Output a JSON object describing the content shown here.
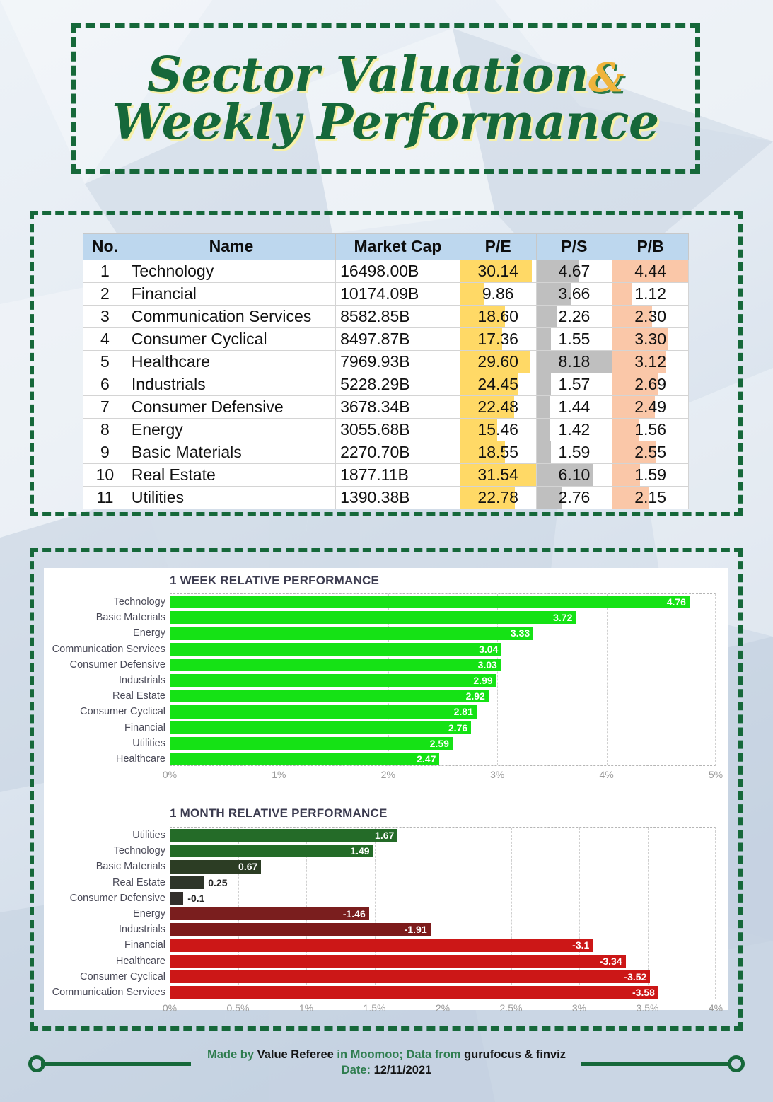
{
  "header": {
    "title_line1": "Sector Valuation",
    "title_amp": "&",
    "title_line2": "Weekly Performance"
  },
  "watermark": "Value Referee",
  "table": {
    "columns": [
      "No.",
      "Name",
      "Market Cap",
      "P/E",
      "P/S",
      "P/B"
    ],
    "colors": {
      "header_bg": "#bdd7ee",
      "pe_bar": "#ffd966",
      "ps_bar": "#bfbfbf",
      "pb_bar": "#fac7a8"
    },
    "rows": [
      {
        "no": "1",
        "name": "Technology",
        "market_cap": "16498.00B",
        "pe": "30.14",
        "ps": "4.67",
        "pb": "4.44",
        "pe_pct": 95,
        "ps_pct": 57,
        "pb_pct": 100
      },
      {
        "no": "2",
        "name": "Financial",
        "market_cap": "10174.09B",
        "pe": "9.86",
        "ps": "3.66",
        "pb": "1.12",
        "pe_pct": 31,
        "ps_pct": 45,
        "pb_pct": 25
      },
      {
        "no": "3",
        "name": "Communication Services",
        "market_cap": "8582.85B",
        "pe": "18.60",
        "ps": "2.26",
        "pb": "2.30",
        "pe_pct": 59,
        "ps_pct": 28,
        "pb_pct": 52
      },
      {
        "no": "4",
        "name": "Consumer Cyclical",
        "market_cap": "8497.87B",
        "pe": "17.36",
        "ps": "1.55",
        "pb": "3.30",
        "pe_pct": 55,
        "ps_pct": 19,
        "pb_pct": 74
      },
      {
        "no": "5",
        "name": "Healthcare",
        "market_cap": "7969.93B",
        "pe": "29.60",
        "ps": "8.18",
        "pb": "3.12",
        "pe_pct": 93,
        "ps_pct": 100,
        "pb_pct": 70
      },
      {
        "no": "6",
        "name": "Industrials",
        "market_cap": "5228.29B",
        "pe": "24.45",
        "ps": "1.57",
        "pb": "2.69",
        "pe_pct": 77,
        "ps_pct": 19,
        "pb_pct": 60
      },
      {
        "no": "7",
        "name": "Consumer Defensive",
        "market_cap": "3678.34B",
        "pe": "22.48",
        "ps": "1.44",
        "pb": "2.49",
        "pe_pct": 71,
        "ps_pct": 18,
        "pb_pct": 56
      },
      {
        "no": "8",
        "name": "Energy",
        "market_cap": "3055.68B",
        "pe": "15.46",
        "ps": "1.42",
        "pb": "1.56",
        "pe_pct": 49,
        "ps_pct": 17,
        "pb_pct": 35
      },
      {
        "no": "9",
        "name": "Basic Materials",
        "market_cap": "2270.70B",
        "pe": "18.55",
        "ps": "1.59",
        "pb": "2.55",
        "pe_pct": 59,
        "ps_pct": 19,
        "pb_pct": 57
      },
      {
        "no": "10",
        "name": "Real Estate",
        "market_cap": "1877.11B",
        "pe": "31.54",
        "ps": "6.10",
        "pb": "1.59",
        "pe_pct": 100,
        "ps_pct": 75,
        "pb_pct": 36
      },
      {
        "no": "11",
        "name": "Utilities",
        "market_cap": "1390.38B",
        "pe": "22.78",
        "ps": "2.76",
        "pb": "2.15",
        "pe_pct": 72,
        "ps_pct": 34,
        "pb_pct": 48
      }
    ]
  },
  "chart_data": [
    {
      "type": "bar",
      "orientation": "horizontal",
      "title": "1 WEEK RELATIVE PERFORMANCE",
      "xlabel": "",
      "ylabel": "",
      "xlim": [
        0,
        5
      ],
      "grid": true,
      "legend": "none",
      "tick_labels": [
        "0%",
        "1%",
        "2%",
        "3%",
        "4%",
        "5%"
      ],
      "tick_values": [
        0,
        1,
        2,
        3,
        4,
        5
      ],
      "categories": [
        "Technology",
        "Basic Materials",
        "Energy",
        "Communication Services",
        "Consumer Defensive",
        "Industrials",
        "Real Estate",
        "Consumer Cyclical",
        "Financial",
        "Utilities",
        "Healthcare"
      ],
      "values": [
        4.76,
        3.72,
        3.33,
        3.04,
        3.03,
        2.99,
        2.92,
        2.81,
        2.76,
        2.59,
        2.47
      ],
      "labels": [
        "4.76",
        "3.72",
        "3.33",
        "3.04",
        "3.03",
        "2.99",
        "2.92",
        "2.81",
        "2.76",
        "2.59",
        "2.47"
      ],
      "bar_colors": [
        "#15e215",
        "#15e215",
        "#15e215",
        "#15e215",
        "#15e215",
        "#15e215",
        "#15e215",
        "#15e215",
        "#15e215",
        "#15e215",
        "#15e215"
      ]
    },
    {
      "type": "bar",
      "orientation": "horizontal",
      "title": "1 MONTH RELATIVE PERFORMANCE",
      "xlabel": "",
      "ylabel": "",
      "xlim": [
        0,
        4
      ],
      "grid": true,
      "legend": "none",
      "tick_labels": [
        "0%",
        "0.5%",
        "1%",
        "1.5%",
        "2%",
        "2.5%",
        "3%",
        "3.5%",
        "4%"
      ],
      "tick_values": [
        0,
        0.5,
        1,
        1.5,
        2,
        2.5,
        3,
        3.5,
        4
      ],
      "categories": [
        "Utilities",
        "Technology",
        "Basic Materials",
        "Real Estate",
        "Consumer Defensive",
        "Energy",
        "Industrials",
        "Financial",
        "Healthcare",
        "Consumer Cyclical",
        "Communication Services"
      ],
      "values": [
        1.67,
        1.49,
        0.67,
        0.25,
        -0.1,
        -1.46,
        -1.91,
        -3.1,
        -3.34,
        -3.52,
        -3.58
      ],
      "labels": [
        "1.67",
        "1.49",
        "0.67",
        "0.25",
        "-0.1",
        "-1.46",
        "-1.91",
        "-3.1",
        "-3.34",
        "-3.52",
        "-3.58"
      ],
      "bar_colors": [
        "#246b28",
        "#246b28",
        "#2c3d24",
        "#2e3529",
        "#332f2c",
        "#7a1e1e",
        "#7d1b1b",
        "#cc1717",
        "#cc1717",
        "#cc1717",
        "#cc1717"
      ],
      "label_inside": [
        true,
        true,
        true,
        false,
        false,
        true,
        true,
        true,
        true,
        true,
        true
      ]
    }
  ],
  "footer": {
    "line1_a": "Made by ",
    "line1_b": "Value Referee",
    "line1_c": " in Moomoo; Data from ",
    "line1_d": "gurufocus & finviz",
    "line2_a": "Date: ",
    "line2_b": "12/11/2021"
  }
}
